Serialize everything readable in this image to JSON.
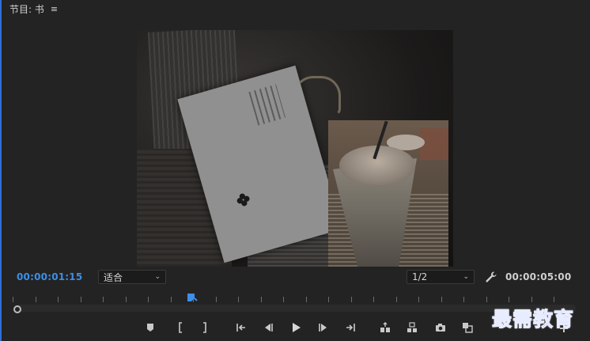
{
  "panel": {
    "title": "节目: 书",
    "menu_icon": "hamburger-icon"
  },
  "timecodes": {
    "current": "00:00:01:15",
    "duration": "00:00:05:00"
  },
  "zoom_select": {
    "value": "适合"
  },
  "resolution_select": {
    "value": "1/2"
  },
  "controls": {
    "icons": [
      "marker-icon",
      "mark-in-icon",
      "mark-out-icon",
      "go-to-in-icon",
      "step-back-icon",
      "play-icon",
      "step-forward-icon",
      "go-to-out-icon",
      "lift-icon",
      "extract-icon",
      "camera-icon",
      "compare-icon",
      "plus-icon"
    ]
  },
  "colors": {
    "accent": "#3d8ee8",
    "panel_bg": "#232323",
    "focus_border": "#2f6fd6"
  },
  "watermark": {
    "text": "最需教育"
  }
}
